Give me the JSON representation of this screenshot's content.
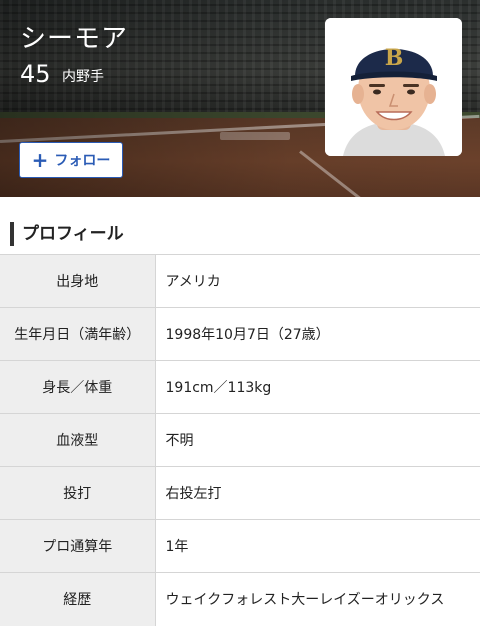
{
  "player": {
    "name": "シーモア",
    "number": "45",
    "position": "内野手"
  },
  "follow": {
    "icon": "plus-icon",
    "label": "フォロー"
  },
  "profile": {
    "title": "プロフィール",
    "rows": [
      {
        "label": "出身地",
        "value": "アメリカ"
      },
      {
        "label": "生年月日（満年齢）",
        "value": "1998年10月7日（27歳）"
      },
      {
        "label": "身長／体重",
        "value": "191cm／113kg"
      },
      {
        "label": "血液型",
        "value": "不明"
      },
      {
        "label": "投打",
        "value": "右投左打"
      },
      {
        "label": "プロ通算年",
        "value": "1年"
      },
      {
        "label": "経歴",
        "value": "ウェイクフォレスト大ーレイズーオリックス"
      }
    ]
  },
  "colors": {
    "accent": "#2a5bb5",
    "cap": "#1c2a4a",
    "cap_logo": "#c9a64a",
    "table_header_bg": "#eeeeee"
  }
}
